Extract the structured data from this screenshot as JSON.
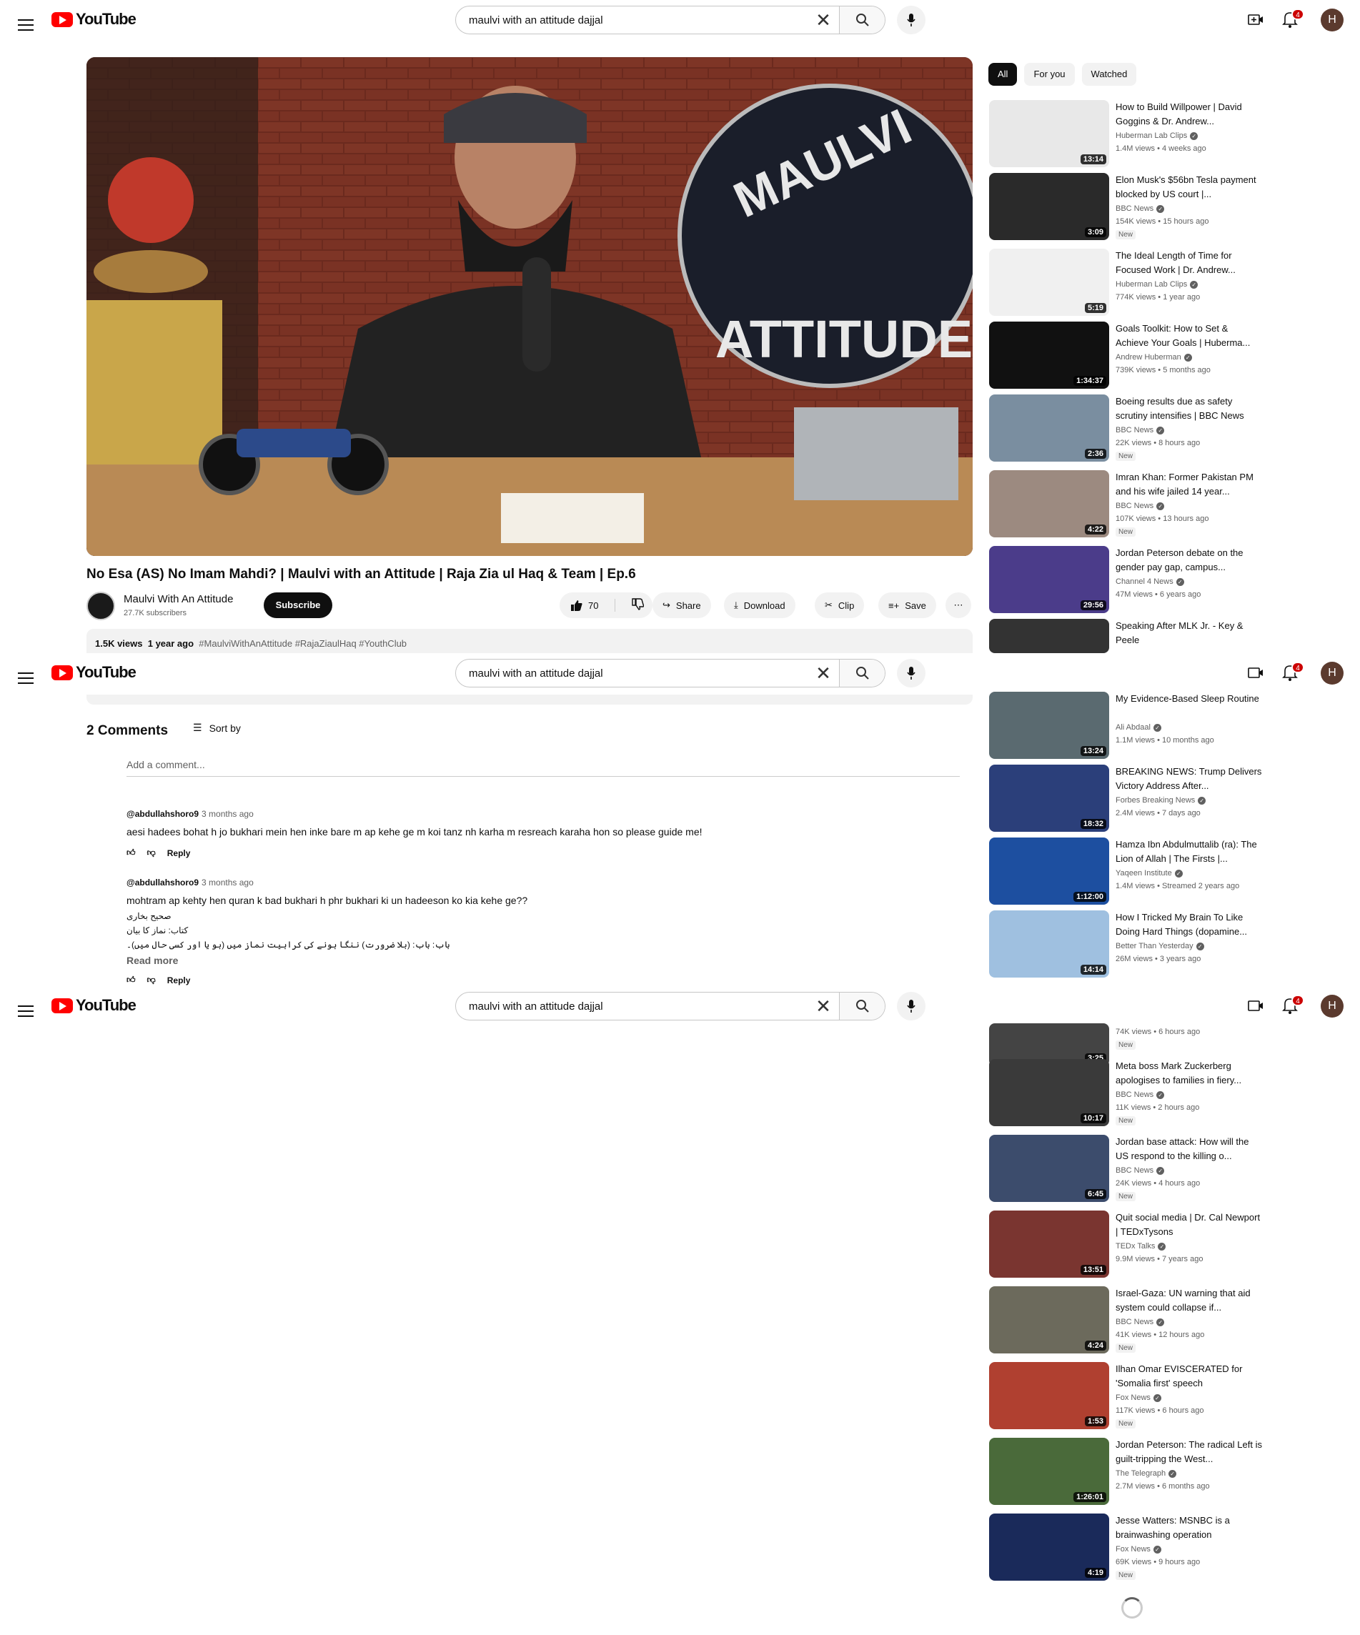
{
  "header": {
    "logo_text": "YouTube",
    "search_value": "maulvi with an attitude dajjal",
    "notifications_count": "4",
    "avatar_letter": "H"
  },
  "video": {
    "title": "No Esa (AS) No Imam Mahdi? | Maulvi with an Attitude | Raja Zia ul Haq & Team | Ep.6",
    "channel": "Maulvi With An Attitude",
    "subscribers": "27.7K subscribers",
    "subscribe_label": "Subscribe",
    "likes": "70",
    "share": "Share",
    "download": "Download",
    "clip": "Clip",
    "save": "Save",
    "views": "1.5K views",
    "age": "1 year ago",
    "tags": "#MaulviWithAnAttitude #RajaZiaulHaq #YouthClub"
  },
  "chips": [
    "All",
    "For you",
    "Watched"
  ],
  "recommendations": [
    {
      "title": "How to Build Willpower | David Goggins & Dr. Andrew...",
      "channel": "Huberman Lab Clips",
      "meta": "1.4M views • 4 weeks ago",
      "duration": "13:14",
      "new": "",
      "color": "#e8e8e8"
    },
    {
      "title": "Elon Musk's $56bn Tesla payment blocked by US court |...",
      "channel": "BBC News",
      "meta": "154K views • 15 hours ago",
      "duration": "3:09",
      "new": "New",
      "color": "#2a2a2a"
    },
    {
      "title": "The Ideal Length of Time for Focused Work | Dr. Andrew...",
      "channel": "Huberman Lab Clips",
      "meta": "774K views • 1 year ago",
      "duration": "5:19",
      "new": "",
      "color": "#f0f0f0"
    },
    {
      "title": "Goals Toolkit: How to Set & Achieve Your Goals | Huberma...",
      "channel": "Andrew Huberman",
      "meta": "739K views • 5 months ago",
      "duration": "1:34:37",
      "new": "",
      "color": "#111111"
    },
    {
      "title": "Boeing results due as safety scrutiny intensifies | BBC News",
      "channel": "BBC News",
      "meta": "22K views • 8 hours ago",
      "duration": "2:36",
      "new": "New",
      "color": "#7a8ea0"
    },
    {
      "title": "Imran Khan: Former Pakistan PM and his wife jailed 14 year...",
      "channel": "BBC News",
      "meta": "107K views • 13 hours ago",
      "duration": "4:22",
      "new": "New",
      "color": "#9c8a80"
    },
    {
      "title": "Jordan Peterson debate on the gender pay gap, campus...",
      "channel": "Channel 4 News",
      "meta": "47M views • 6 years ago",
      "duration": "29:56",
      "new": "",
      "color": "#4b3c8a"
    },
    {
      "title": "Speaking After MLK Jr. - Key & Peele",
      "channel": "",
      "meta": "",
      "duration": "",
      "new": "",
      "color": "#333333"
    },
    {
      "title": "My Evidence-Based Sleep Routine",
      "channel": "Ali Abdaal",
      "meta": "1.1M views • 10 months ago",
      "duration": "13:24",
      "new": "",
      "color": "#5a6a70"
    },
    {
      "title": "BREAKING NEWS: Trump Delivers Victory Address After...",
      "channel": "Forbes Breaking News",
      "meta": "2.4M views • 7 days ago",
      "duration": "18:32",
      "new": "",
      "color": "#2b3f7a"
    },
    {
      "title": "Hamza Ibn Abdulmuttalib (ra): The Lion of Allah | The Firsts |...",
      "channel": "Yaqeen Institute",
      "meta": "1.4M views • Streamed 2 years ago",
      "duration": "1:12:00",
      "new": "",
      "color": "#1d4fa0"
    },
    {
      "title": "How I Tricked My Brain To Like Doing Hard Things (dopamine...",
      "channel": "Better Than Yesterday",
      "meta": "26M views • 3 years ago",
      "duration": "14:14",
      "new": "",
      "color": "#9fc0e0"
    },
    {
      "title": "",
      "channel": "",
      "meta": "74K views • 6 hours ago",
      "duration": "3:25",
      "new": "New",
      "color": "#444444"
    },
    {
      "title": "Meta boss Mark Zuckerberg apologises to families in fiery...",
      "channel": "BBC News",
      "meta": "11K views • 2 hours ago",
      "duration": "10:17",
      "new": "New",
      "color": "#3a3a3a"
    },
    {
      "title": "Jordan base attack: How will the US respond to the killing o...",
      "channel": "BBC News",
      "meta": "24K views • 4 hours ago",
      "duration": "6:45",
      "new": "New",
      "color": "#3c4c6c"
    },
    {
      "title": "Quit social media | Dr. Cal Newport | TEDxTysons",
      "channel": "TEDx Talks",
      "meta": "9.9M views • 7 years ago",
      "duration": "13:51",
      "new": "",
      "color": "#7a3530"
    },
    {
      "title": "Israel-Gaza: UN warning that aid system could collapse if...",
      "channel": "BBC News",
      "meta": "41K views • 12 hours ago",
      "duration": "4:24",
      "new": "New",
      "color": "#6c6a5c"
    },
    {
      "title": "Ilhan Omar EVISCERATED for 'Somalia first' speech",
      "channel": "Fox News",
      "meta": "117K views • 6 hours ago",
      "duration": "1:53",
      "new": "New",
      "color": "#b04030"
    },
    {
      "title": "Jordan Peterson: The radical Left is guilt-tripping the West...",
      "channel": "The Telegraph",
      "meta": "2.7M views • 6 months ago",
      "duration": "1:26:01",
      "new": "",
      "color": "#4a6a3a"
    },
    {
      "title": "Jesse Watters: MSNBC is a brainwashing operation",
      "channel": "Fox News",
      "meta": "69K views • 9 hours ago",
      "duration": "4:19",
      "new": "New",
      "color": "#1a2a5a"
    }
  ],
  "comments_section": {
    "count_label": "2 Comments",
    "sort_label": "Sort by",
    "add_placeholder": "Add a comment...",
    "reply_label": "Reply",
    "read_more": "Read more",
    "comments": [
      {
        "author": "@abdullahshoro9",
        "age": "3 months ago",
        "text": "aesi hadees bohat h jo bukhari mein hen inke bare m ap kehe ge m koi tanz nh karha m resreach karaha hon so please guide me!"
      },
      {
        "author": "@abdullahshoro9",
        "age": "3 months ago",
        "text": "mohtram ap kehty hen quran k bad bukhari h phr bukhari ki un hadeeson ko kia kehe ge??",
        "extra": [
          "صحیح بخاری",
          "کتاب: نماز کا بیان",
          "باب: باب: (بلا ضرورت) ننگا ہونے کی کراہیت نماز میں (ہو یا اور کسی حال میں)۔"
        ]
      }
    ]
  }
}
